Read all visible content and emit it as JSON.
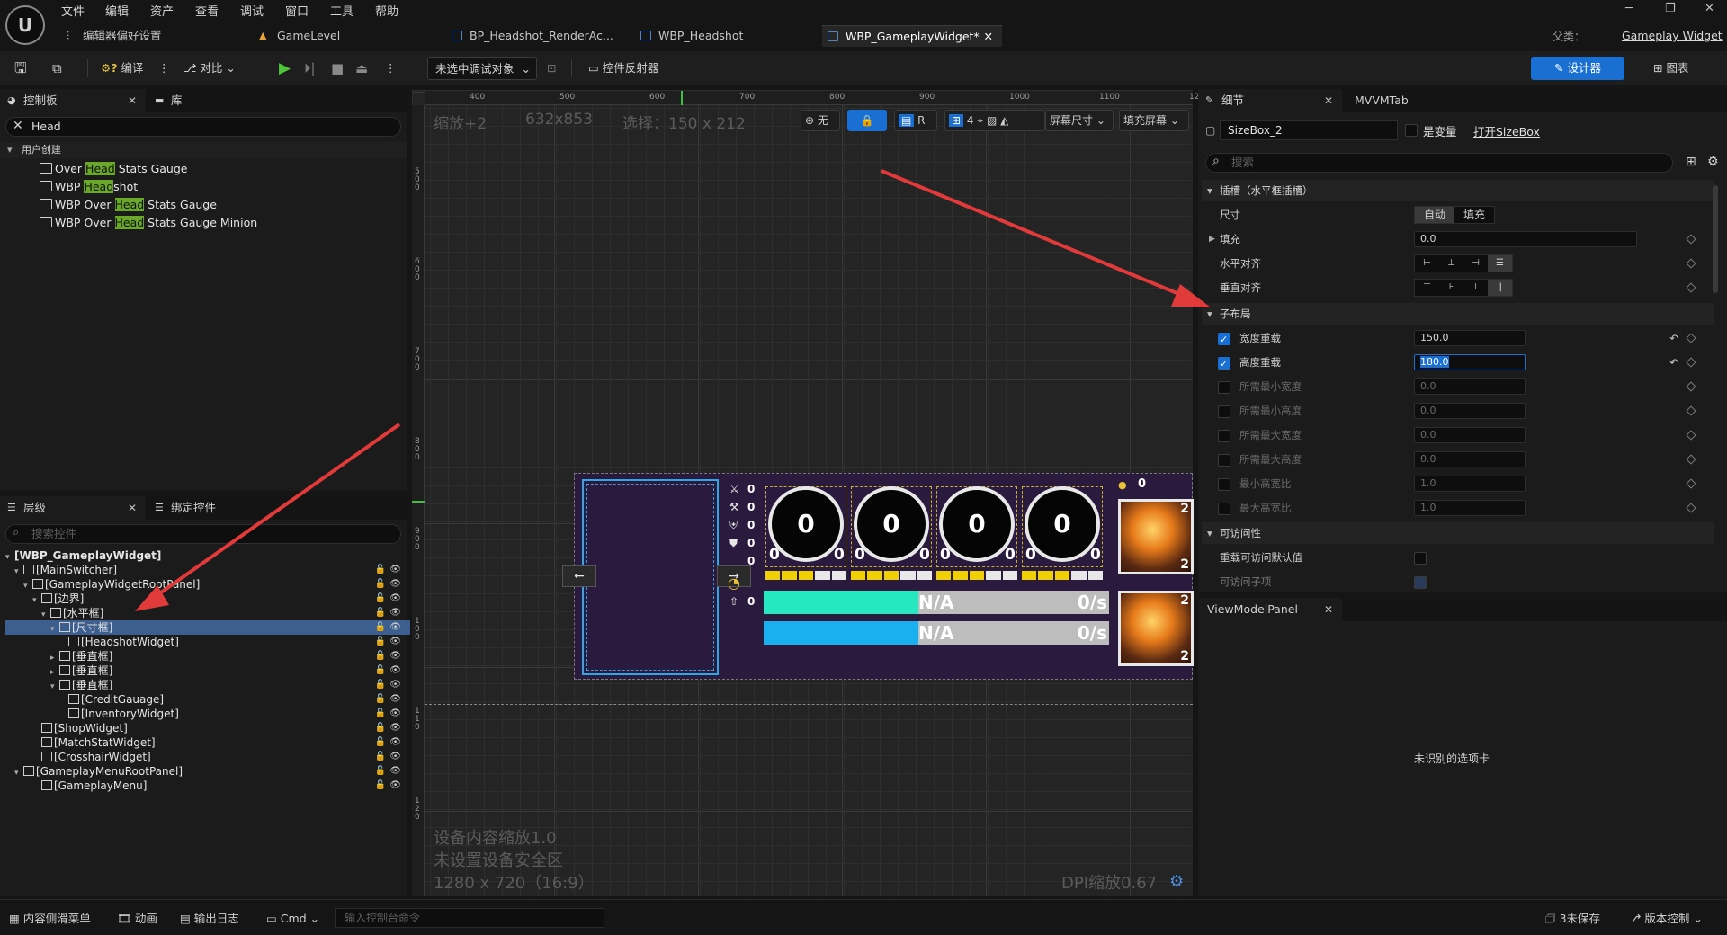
{
  "menu": [
    "文件",
    "编辑",
    "资产",
    "查看",
    "调试",
    "窗口",
    "工具",
    "帮助"
  ],
  "tabs": {
    "editor_prefs": "编辑器偏好设置",
    "game_level": "GameLevel",
    "bp_headshot": "BP_Headshot_RenderAc...",
    "wbp_headshot": "WBP_Headshot",
    "wbp_gameplay": "WBP_GameplayWidget*"
  },
  "parent_class": {
    "label": "父类：",
    "value": "Gameplay Widget"
  },
  "toolbar": {
    "compile": "编译",
    "diff": "对比",
    "debug_target": "未选中调试对象",
    "widget_reflector": "控件反射器",
    "designer": "设计器",
    "graph": "图表"
  },
  "palette": {
    "tab_palette": "控制板",
    "tab_library": "库",
    "search_value": "Head",
    "category": "用户创建",
    "items": [
      {
        "pre": "Over ",
        "hl": "Head",
        "post": " Stats Gauge"
      },
      {
        "pre": "WBP ",
        "hl": "Head",
        "post": "shot"
      },
      {
        "pre": "WBP Over ",
        "hl": "Head",
        "post": " Stats Gauge"
      },
      {
        "pre": "WBP Over ",
        "hl": "Head",
        "post": " Stats Gauge Minion"
      }
    ]
  },
  "hierarchy": {
    "tab_hierarchy": "层级",
    "tab_bind": "绑定控件",
    "search_placeholder": "搜索控件",
    "rows": [
      {
        "label": "[WBP_GameplayWidget]",
        "bold": true
      },
      {
        "label": "[MainSwitcher]"
      },
      {
        "label": "[GameplayWidgetRootPanel]"
      },
      {
        "label": "[边界]"
      },
      {
        "label": "[水平框]"
      },
      {
        "label": "[尺寸框]",
        "selected": true
      },
      {
        "label": "[HeadshotWidget]"
      },
      {
        "label": "[垂直框]"
      },
      {
        "label": "[垂直框]"
      },
      {
        "label": "[垂直框]"
      },
      {
        "label": "[CreditGauage]"
      },
      {
        "label": "[InventoryWidget]"
      },
      {
        "label": "[ShopWidget]"
      },
      {
        "label": "[MatchStatWidget]"
      },
      {
        "label": "[CrosshairWidget]"
      },
      {
        "label": "[GameplayMenuRootPanel]"
      },
      {
        "label": "[GameplayMenu]"
      }
    ]
  },
  "canvas": {
    "zoom": "缩放+2",
    "size": "632x853",
    "selection": "选择：150 x 212",
    "none_label": "无",
    "r_label": "R",
    "grid_num": "4",
    "screen_size": "屏幕尺寸",
    "fill_screen": "填充屏幕",
    "ruler_h": [
      "400",
      "500",
      "600",
      "700",
      "800",
      "900",
      "1000",
      "1100",
      "12"
    ],
    "ruler_v": [
      "5\n0\n0",
      "6\n0\n0",
      "7\n0\n0",
      "8\n0\n0",
      "9\n0\n0",
      "1\n0\n0",
      "1\n1\n0",
      "1\n2\n0"
    ],
    "device_scale": "设备内容缩放1.0",
    "safe_zone": "未设置设备安全区",
    "resolution": "1280 x 720（16:9）",
    "dpi": "DPI缩放0.67",
    "gauges": [
      "0",
      "0",
      "0",
      "0"
    ],
    "gauge_small": "0",
    "side_stats": [
      "0",
      "0",
      "0",
      "0",
      "0",
      "0"
    ],
    "bar1_text": "N/A",
    "bar1_rate": "0/s",
    "bar2_text": "N/A",
    "bar2_rate": "0/s",
    "card_num": "2",
    "coin": "0",
    "arrow_left": "←",
    "arrow_right": "→"
  },
  "details": {
    "tab_details": "细节",
    "tab_mvvm": "MVVMTab",
    "name": "SizeBox_2",
    "is_variable": "是变量",
    "open_link": "打开SizeBox",
    "search_placeholder": "搜索",
    "slot_section": "插槽（水平框插槽）",
    "size_label": "尺寸",
    "size_auto": "自动",
    "size_fill": "填充",
    "fill_label": "填充",
    "fill_value": "0.0",
    "halign_label": "水平对齐",
    "valign_label": "垂直对齐",
    "child_layout_section": "子布局",
    "width_override": "宽度重载",
    "width_value": "150.0",
    "height_override": "高度重载",
    "height_value": "180.0",
    "min_width": "所需最小宽度",
    "min_width_v": "0.0",
    "min_height": "所需最小高度",
    "min_height_v": "0.0",
    "max_width": "所需最大宽度",
    "max_width_v": "0.0",
    "max_height": "所需最大高度",
    "max_height_v": "0.0",
    "min_aspect": "最小高宽比",
    "min_aspect_v": "1.0",
    "max_aspect": "最大高宽比",
    "max_aspect_v": "1.0",
    "access_section": "可访问性",
    "override_access": "重载可访问默认值",
    "access_children": "可访问子项"
  },
  "viewmodel": {
    "tab": "ViewModelPanel",
    "unknown": "未识别的选项卡"
  },
  "statusbar": {
    "content_drawer": "内容侧滑菜单",
    "animation": "动画",
    "output_log": "输出日志",
    "cmd": "Cmd",
    "console_placeholder": "输入控制台命令",
    "unsaved": "3未保存",
    "source_control": "版本控制"
  },
  "colors": {
    "accent": "#1a6fd3",
    "highlight": "#6aa82a",
    "widget_bg": "#2a1a3d",
    "arrow": "#e03a3a"
  }
}
